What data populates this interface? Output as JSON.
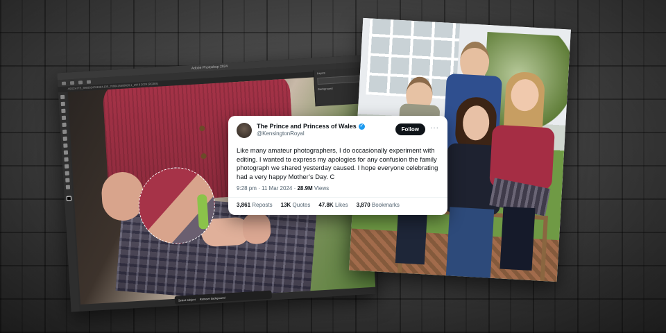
{
  "photoshop": {
    "window_title": "Adobe Photoshop 2024",
    "doc_tab": "4SSZH7T5_8905024781084,100_7006415589810,1_2W 8 2024 (RGB/8)",
    "layers_title": "Layers",
    "layer_name": "Background",
    "taskbar_select": "Select subject",
    "taskbar_remove": "Remove background"
  },
  "tweet": {
    "display_name": "The Prince and Princess of Wales",
    "handle": "@KensingtonRoyal",
    "follow_label": "Follow",
    "more_label": "···",
    "text": "Like many amateur photographers, I do occasionally experiment with editing. I wanted to express my apologies for any confusion the family photograph we shared yesterday caused. I hope everyone celebrating had a very happy Mother’s Day. C",
    "time": "9:28 pm · 11 Mar 2024 · ",
    "views_count": "28.9M",
    "views_label": " Views",
    "reposts_count": "3,861",
    "reposts_label": "Reposts",
    "quotes_count": "13K",
    "quotes_label": "Quotes",
    "likes_count": "47.8K",
    "likes_label": "Likes",
    "bookmarks_count": "3,870",
    "bookmarks_label": "Bookmarks",
    "verified_color": "#1d9bf0"
  }
}
